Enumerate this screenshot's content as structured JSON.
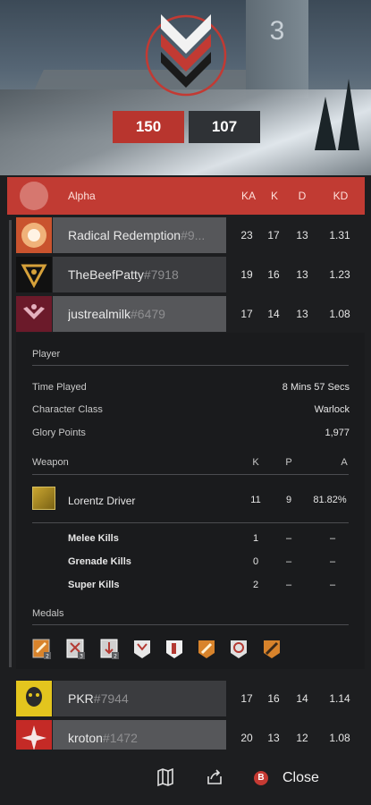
{
  "hero": {
    "tower_number": "3"
  },
  "scores": {
    "team_a": "150",
    "team_b": "107"
  },
  "team": {
    "name": "Alpha",
    "columns": [
      "KA",
      "K",
      "D",
      "KD"
    ]
  },
  "players": [
    {
      "name": "Radical Redemption",
      "tag": "#9...",
      "ka": "23",
      "k": "17",
      "d": "13",
      "kd": "1.31"
    },
    {
      "name": "TheBeefPatty",
      "tag": "#7918",
      "ka": "19",
      "k": "16",
      "d": "13",
      "kd": "1.23"
    },
    {
      "name": "justrealmilk",
      "tag": "#6479",
      "ka": "17",
      "k": "14",
      "d": "13",
      "kd": "1.08"
    },
    {
      "name": "PKR",
      "tag": "#7944",
      "ka": "17",
      "k": "16",
      "d": "14",
      "kd": "1.14"
    },
    {
      "name": "kroton",
      "tag": "#1472",
      "ka": "20",
      "k": "13",
      "d": "12",
      "kd": "1.08"
    }
  ],
  "detail": {
    "player_section": "Player",
    "time_played_label": "Time Played",
    "time_played_value": "8 Mins 57 Secs",
    "class_label": "Character Class",
    "class_value": "Warlock",
    "glory_label": "Glory Points",
    "glory_value": "1,977",
    "weapon_section": "Weapon",
    "weapon_cols": [
      "K",
      "P",
      "A"
    ],
    "weapon": {
      "name": "Lorentz Driver",
      "k": "11",
      "p": "9",
      "a": "81.82%"
    },
    "kills": [
      {
        "label": "Melee Kills",
        "k": "1",
        "p": "–",
        "a": "–"
      },
      {
        "label": "Grenade Kills",
        "k": "0",
        "p": "–",
        "a": "–"
      },
      {
        "label": "Super Kills",
        "k": "2",
        "p": "–",
        "a": "–"
      }
    ],
    "medals_section": "Medals",
    "medal_counts": [
      "2",
      "3",
      "2"
    ]
  },
  "bottom": {
    "close_label": "Close",
    "close_key": "B"
  },
  "colors": {
    "accent_red": "#c13b33",
    "score_red": "#b8352e"
  }
}
